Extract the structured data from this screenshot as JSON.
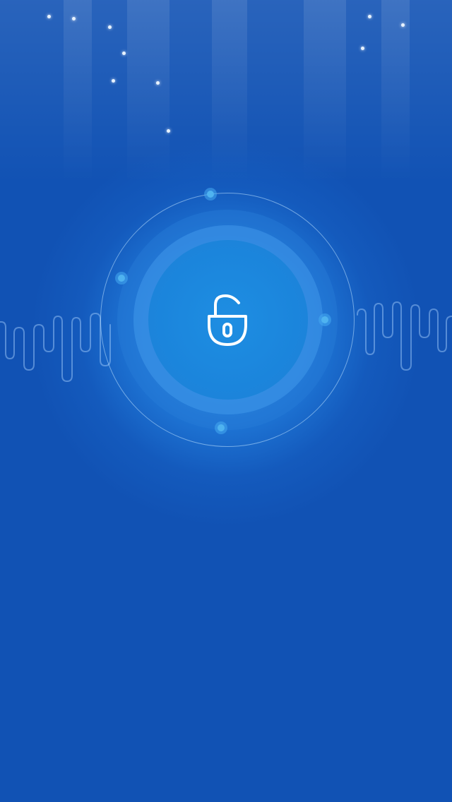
{
  "screen": {
    "name": "unlock-screen",
    "background_color": "#1152b4",
    "glow_color": "#2896eb"
  },
  "unlock_button": {
    "icon": "unlock-icon",
    "state": "unlocked"
  },
  "decorations": {
    "icons": [
      "star-icon",
      "orbit-dot-icon",
      "sound-wave-icon"
    ]
  }
}
